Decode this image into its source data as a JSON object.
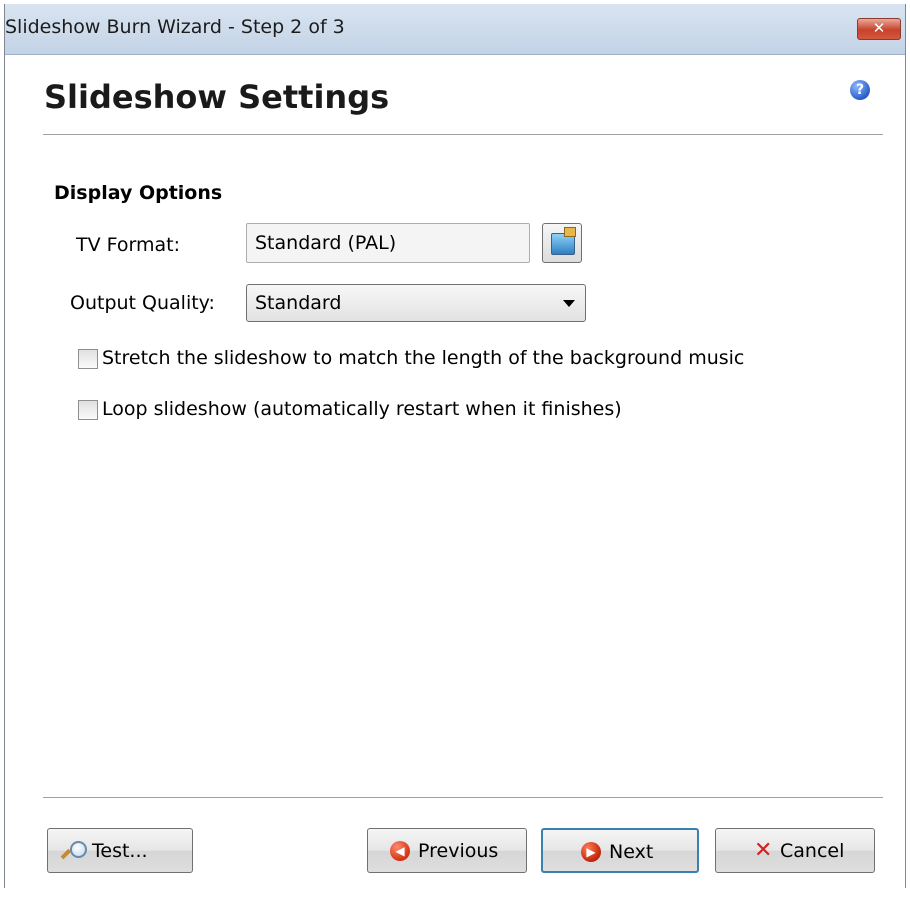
{
  "window": {
    "title": "Slideshow Burn Wizard - Step 2 of 3",
    "close_glyph": "✕"
  },
  "page": {
    "title": "Slideshow Settings",
    "help_glyph": "?"
  },
  "display_options": {
    "heading": "Display Options",
    "tv_format_label": "TV Format:",
    "tv_format_value": "Standard (PAL)",
    "output_quality_label": "Output Quality:",
    "output_quality_value": "Standard"
  },
  "checkboxes": [
    {
      "label": "Stretch the slideshow to match the length of the background music",
      "checked": false
    },
    {
      "label": "Loop slideshow (automatically restart when it finishes)",
      "checked": false
    }
  ],
  "buttons": {
    "test": "Test...",
    "previous": "Previous",
    "next": "Next",
    "cancel": "Cancel"
  },
  "icons": {
    "help": "help-icon",
    "tv_format_picker": "tv-format-icon",
    "test": "magnifier-icon",
    "previous": "arrow-left-circle-icon",
    "next": "arrow-right-circle-icon",
    "cancel": "x-icon",
    "close": "close-icon"
  }
}
